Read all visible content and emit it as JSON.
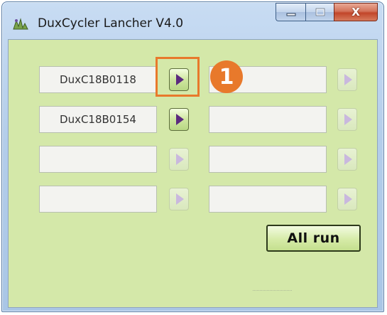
{
  "window": {
    "title": "DuxCycler Lancher V4.0",
    "close_symbol": "X"
  },
  "slots": [
    {
      "value": "DuxC18B0118",
      "enabled": true
    },
    {
      "value": "",
      "enabled": false
    },
    {
      "value": "DuxC18B0154",
      "enabled": true
    },
    {
      "value": "",
      "enabled": false
    },
    {
      "value": "",
      "enabled": false
    },
    {
      "value": "",
      "enabled": false
    },
    {
      "value": "",
      "enabled": false
    },
    {
      "value": "",
      "enabled": false
    }
  ],
  "actions": {
    "all_run_label": "All run"
  },
  "annotation": {
    "step_number": "1"
  },
  "colors": {
    "client_bg": "#d4e8a9",
    "annotation": "#e8792b",
    "play_enabled": "#5b2b7e",
    "play_disabled": "#c9b8de"
  },
  "icons": [
    "app-icon",
    "minimize-icon",
    "maximize-icon",
    "close-icon",
    "play-icon"
  ]
}
